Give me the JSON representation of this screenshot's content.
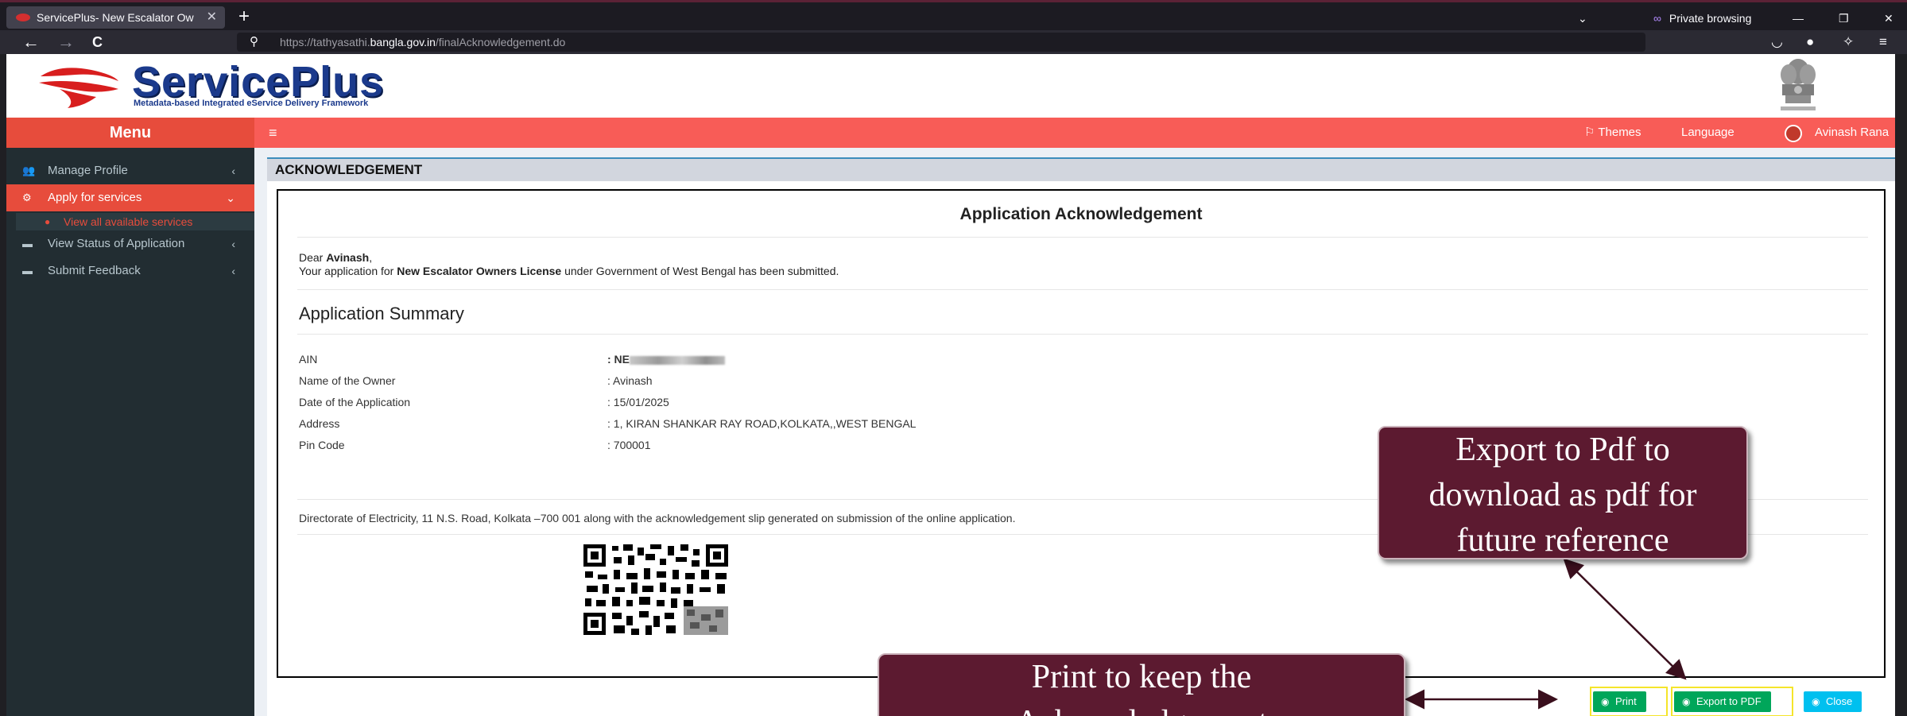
{
  "browser": {
    "tab_title": "ServicePlus- New Escalator Ow",
    "tab_close": "✕",
    "new_tab": "+",
    "private_label": "Private browsing",
    "url_prefix": "https://tathyasathi.",
    "url_host": "bangla.gov.in",
    "url_path": "/finalAcknowledgement.do",
    "back": "←",
    "forward": "→",
    "reload": "C"
  },
  "header": {
    "logo_text": "ServicePlus",
    "logo_subtitle": "Metadata-based Integrated eService Delivery Framework"
  },
  "sidebar": {
    "menu_label": "Menu",
    "items": [
      {
        "label": "Manage Profile",
        "icon": "users-icon",
        "chevron": "‹"
      },
      {
        "label": "Apply for services",
        "icon": "cogs-icon",
        "chevron": "⌄"
      },
      {
        "label": "View Status of Application",
        "icon": "card-icon",
        "chevron": "‹"
      },
      {
        "label": "Submit Feedback",
        "icon": "card-icon",
        "chevron": "‹"
      }
    ],
    "sub_item": "View all available services"
  },
  "topnav": {
    "hamburger": "≡",
    "themes": "⚐ Themes",
    "language": "Language",
    "user": "Avinash Rana"
  },
  "content": {
    "box_title": "ACKNOWLEDGEMENT",
    "ack_title": "Application Acknowledgement",
    "dear_prefix": "Dear ",
    "dear_name": "Avinash",
    "dear_suffix": ",",
    "msg_prefix": "Your application for ",
    "msg_service": "New Escalator Owners License",
    "msg_suffix": " under Government of West Bengal has been submitted.",
    "summary_title": "Application Summary",
    "rows": [
      {
        "label": "AIN",
        "value": ": NE"
      },
      {
        "label": "Name of the Owner",
        "value": ": Avinash"
      },
      {
        "label": "Date of the Application",
        "value": ": 15/01/2025"
      },
      {
        "label": "Address",
        "value": ": 1, KIRAN SHANKAR RAY ROAD,KOLKATA,,WEST BENGAL"
      },
      {
        "label": "Pin Code",
        "value": ": 700001"
      }
    ],
    "directorate": "Directorate of Electricity, 11 N.S. Road, Kolkata –700 001 along with the acknowledgement slip generated on submission of the online application."
  },
  "buttons": {
    "print": "Print",
    "export": "Export to PDF",
    "close": "Close"
  },
  "callouts": {
    "pdf": [
      "Export to Pdf to",
      "download as pdf for",
      "future reference"
    ],
    "print": [
      "Print to keep the",
      "Acknowledgement"
    ]
  },
  "colors": {
    "menu_red": "#e74c3c",
    "topnav_red": "#f85c57",
    "sidebar_dark": "#222d32",
    "callout_maroon": "#5c1a30",
    "button_green": "#00a65a",
    "button_cyan": "#00c0ef"
  }
}
